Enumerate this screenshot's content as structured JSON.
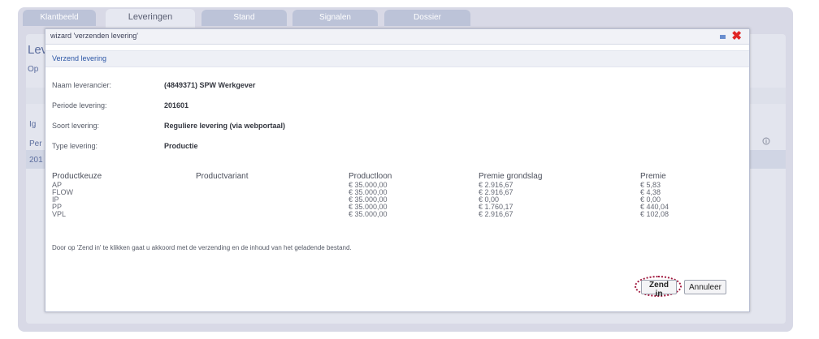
{
  "tabs": [
    {
      "label": "Klantbeeld"
    },
    {
      "label": "Leveringen"
    },
    {
      "label": "Stand"
    },
    {
      "label": "Signalen"
    },
    {
      "label": "Dossier"
    }
  ],
  "background": {
    "heading_fragment": "Lev",
    "subtitle_fragment": "Op",
    "button_fragment": "Ig",
    "row_label_fragment": "Per",
    "row_value_fragment": "201",
    "info_icon": "info-icon"
  },
  "wizard": {
    "title": "wizard 'verzenden levering'",
    "section_title": "Verzend levering",
    "fields": [
      {
        "label": "Naam leverancier:",
        "value": "(4849371) SPW Werkgever"
      },
      {
        "label": "Periode levering:",
        "value": "201601"
      },
      {
        "label": "Soort levering:",
        "value": "Reguliere levering (via webportaal)"
      },
      {
        "label": "Type levering:",
        "value": "Productie"
      }
    ],
    "table": {
      "headers": {
        "productkeuze": "Productkeuze",
        "productvariant": "Productvariant",
        "productloon": "Productloon",
        "premie_grondslag": "Premie grondslag",
        "premie": "Premie"
      },
      "rows": [
        {
          "product": "AP",
          "variant": "",
          "loon": "€ 35.000,00",
          "grondslag": "€ 2.916,67",
          "premie": "€ 5,83"
        },
        {
          "product": "FLOW",
          "variant": "",
          "loon": "€ 35.000,00",
          "grondslag": "€ 2.916,67",
          "premie": "€ 4,38"
        },
        {
          "product": "IP",
          "variant": "",
          "loon": "€ 35.000,00",
          "grondslag": "€ 0,00",
          "premie": "€ 0,00"
        },
        {
          "product": "PP",
          "variant": "",
          "loon": "€ 35.000,00",
          "grondslag": "€ 1.760,17",
          "premie": "€ 440,04"
        },
        {
          "product": "VPL",
          "variant": "",
          "loon": "€ 35.000,00",
          "grondslag": "€ 2.916,67",
          "premie": "€ 102,08"
        }
      ]
    },
    "notice": "Door op 'Zend in' te klikken gaat u akkoord met de verzending en de inhoud van het geladende bestand.",
    "buttons": {
      "submit": "Zend in",
      "cancel": "Annuleer"
    },
    "close_glyph": "✖",
    "accent_colors": {
      "section_title": "#2d57a6",
      "close": "#e02525",
      "highlight": "#a0173d"
    }
  }
}
